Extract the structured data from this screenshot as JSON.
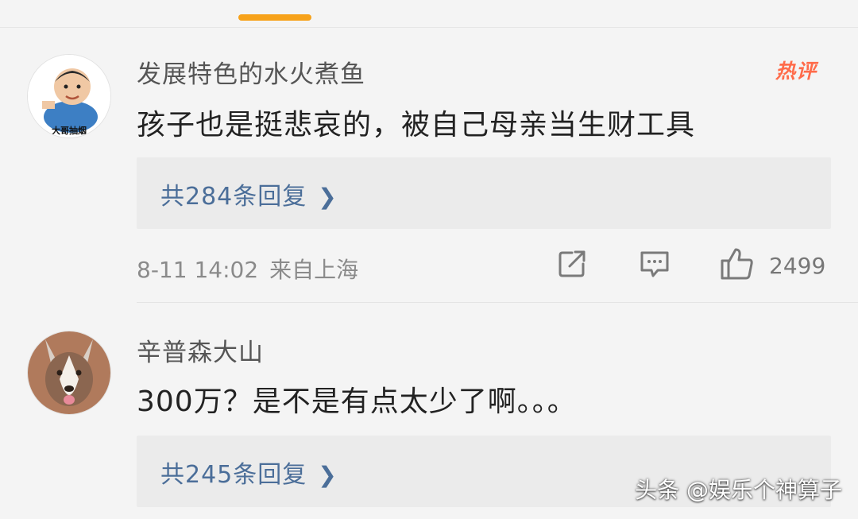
{
  "comments": [
    {
      "username": "发展特色的水火煮鱼",
      "avatar_caption": "大哥抽烟",
      "badge": "热评",
      "text": "孩子也是挺悲哀的，被自己母亲当生财工具",
      "replies_label": "共284条回复",
      "time": "8-11 14:02",
      "location": "来自上海",
      "likes": "2499"
    },
    {
      "username": "辛普森大山",
      "text": "300万？是不是有点太少了啊。。。",
      "replies_label": "共245条回复"
    }
  ],
  "icons": {
    "chevron": "chevron-right-icon",
    "share": "share-icon",
    "reply": "comment-icon",
    "like": "thumbs-up-icon"
  },
  "colors": {
    "accent_tab": "#f7a21a",
    "hot_badge": "#ff6b4a",
    "link": "#4b6e99"
  },
  "watermark": "头条 @娱乐个神算子"
}
